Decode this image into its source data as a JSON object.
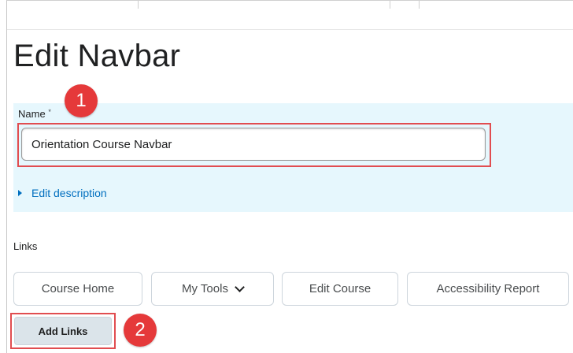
{
  "page": {
    "title": "Edit Navbar"
  },
  "form": {
    "name_label": "Name",
    "required_marker": "*",
    "name_value": "Orientation Course Navbar",
    "edit_description_label": "Edit description",
    "links_label": "Links"
  },
  "links": {
    "items": [
      {
        "label": "Course Home"
      },
      {
        "label": "My Tools"
      },
      {
        "label": "Edit Course"
      },
      {
        "label": "Accessibility Report"
      }
    ],
    "add_links_label": "Add Links"
  },
  "annotations": {
    "step1": "1",
    "step2": "2"
  },
  "colors": {
    "panel_bg": "#e6f7fd",
    "highlight": "#e14d50",
    "badge": "#e5393a",
    "link": "#006fbf"
  },
  "icons": {
    "expand": "caret-right-icon",
    "dropdown": "chevron-down-icon"
  }
}
